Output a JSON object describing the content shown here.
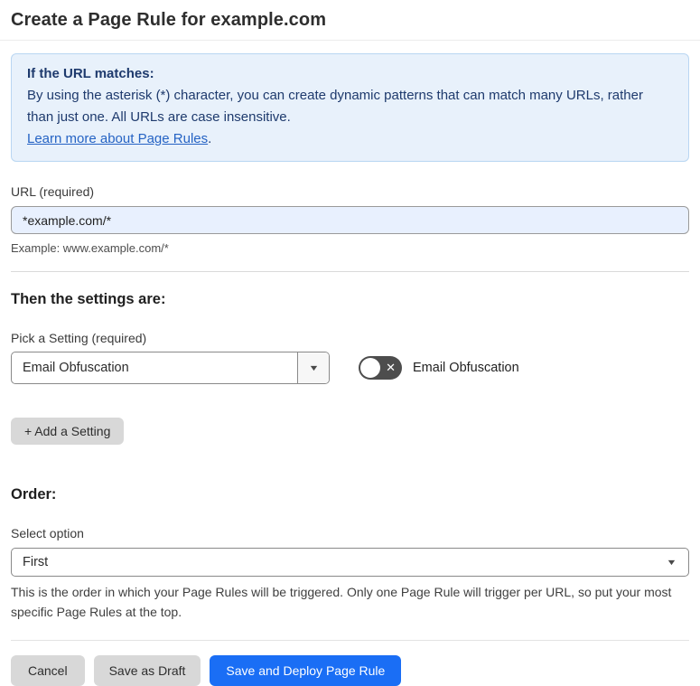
{
  "page": {
    "title": "Create a Page Rule for example.com"
  },
  "info_box": {
    "heading": "If the URL matches:",
    "body": "By using the asterisk (*) character, you can create dynamic patterns that can match many URLs, rather than just one. All URLs are case insensitive.",
    "link_label": "Learn more about Page Rules",
    "link_suffix": "."
  },
  "url_field": {
    "label": "URL (required)",
    "value": "*example.com/*",
    "helper": "Example: www.example.com/*"
  },
  "settings_section": {
    "heading": "Then the settings are:",
    "picker_label": "Pick a Setting (required)",
    "picker_value": "Email Obfuscation",
    "toggle_label": "Email Obfuscation",
    "toggle_state": "off",
    "add_button_label": "+ Add a Setting"
  },
  "order_section": {
    "heading": "Order:",
    "select_label": "Select option",
    "select_value": "First",
    "helper": "This is the order in which your Page Rules will be triggered. Only one Page Rule will trigger per URL, so put your most specific Page Rules at the top."
  },
  "footer": {
    "cancel_label": "Cancel",
    "save_draft_label": "Save as Draft",
    "save_deploy_label": "Save and Deploy Page Rule"
  },
  "icons": {
    "chevron_down": "▼",
    "close_x": "✕"
  },
  "colors": {
    "accent_blue": "#1a6ef5",
    "info_bg": "#e8f1fb",
    "info_border": "#b9d6f2",
    "info_text": "#1e3a6d",
    "link_blue": "#2563c4",
    "input_bg": "#e8f0fe",
    "toggle_off_bg": "#4d4d4d",
    "gray_button_bg": "#d8d8d8"
  }
}
